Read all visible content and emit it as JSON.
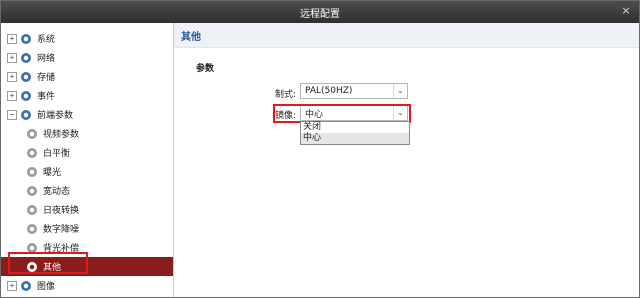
{
  "window": {
    "title": "远程配置",
    "close_glyph": "×"
  },
  "sidebar": {
    "items": [
      {
        "label": "系统",
        "expander": "+",
        "icon": "gear-icon"
      },
      {
        "label": "网络",
        "expander": "+",
        "icon": "gear-icon"
      },
      {
        "label": "存储",
        "expander": "+",
        "icon": "gear-icon"
      },
      {
        "label": "事件",
        "expander": "+",
        "icon": "gear-icon"
      },
      {
        "label": "前端参数",
        "expander": "−",
        "icon": "gear-icon"
      },
      {
        "label": "视频参数",
        "icon": "gear-icon"
      },
      {
        "label": "白平衡",
        "icon": "gear-icon"
      },
      {
        "label": "曝光",
        "icon": "gear-icon"
      },
      {
        "label": "宽动态",
        "icon": "gear-icon"
      },
      {
        "label": "日夜转换",
        "icon": "gear-icon"
      },
      {
        "label": "数字降噪",
        "icon": "gear-icon"
      },
      {
        "label": "背光补偿",
        "icon": "gear-icon"
      },
      {
        "label": "其他",
        "icon": "gear-icon",
        "selected": true
      },
      {
        "label": "图像",
        "expander": "+",
        "icon": "gear-icon"
      }
    ]
  },
  "main": {
    "section_title": "其他",
    "group_title": "参数",
    "standard": {
      "label": "制式:",
      "value": "PAL(50HZ)"
    },
    "mirror": {
      "label": "镜像:",
      "value": "中心",
      "options": [
        "关闭",
        "中心"
      ]
    }
  },
  "colors": {
    "accent": "#8b1c1c",
    "highlight": "#e0191a",
    "header_text": "#2b5a9a"
  }
}
